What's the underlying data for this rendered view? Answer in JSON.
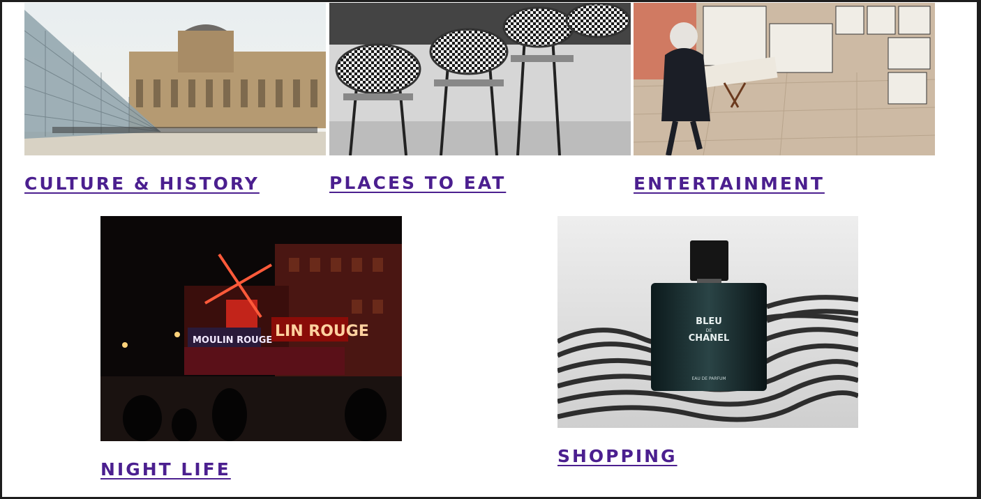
{
  "categories": {
    "culture": {
      "label": "CULTURE & HISTORY",
      "image": "louvre-pyramid-photo"
    },
    "eat": {
      "label": "PLACES TO EAT",
      "image": "cafe-chairs-photo"
    },
    "entertainment": {
      "label": "ENTERTAINMENT",
      "image": "street-art-vendor-photo"
    },
    "nightlife": {
      "label": "NIGHT LIFE",
      "image": "moulin-rouge-photo"
    },
    "shopping": {
      "label": "SHOPPING",
      "image": "perfume-bottle-photo"
    }
  },
  "photo_text": {
    "moulin_rouge": "MOULIN ROUGE",
    "du_moulin_rouge": "LIN ROUGE",
    "perfume_brand": "BLEU",
    "perfume_de": "DE",
    "perfume_house": "CHANEL",
    "perfume_type": "EAU DE PARFUM"
  },
  "colors": {
    "link": "#4b1f8f",
    "frame": "#1d1d1d"
  }
}
